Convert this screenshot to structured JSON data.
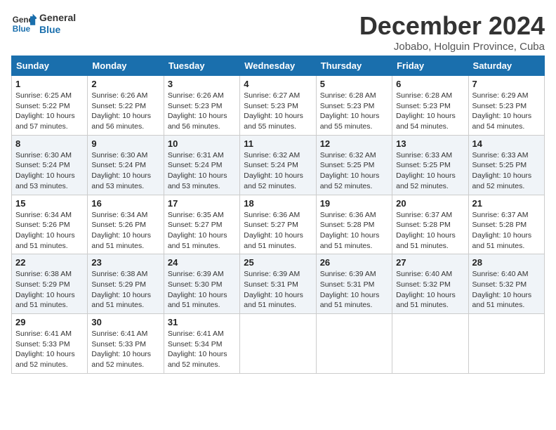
{
  "logo": {
    "line1": "General",
    "line2": "Blue"
  },
  "title": "December 2024",
  "location": "Jobabo, Holguin Province, Cuba",
  "headers": [
    "Sunday",
    "Monday",
    "Tuesday",
    "Wednesday",
    "Thursday",
    "Friday",
    "Saturday"
  ],
  "weeks": [
    [
      {
        "day": "1",
        "sunrise": "6:25 AM",
        "sunset": "5:22 PM",
        "daylight": "10 hours and 57 minutes."
      },
      {
        "day": "2",
        "sunrise": "6:26 AM",
        "sunset": "5:22 PM",
        "daylight": "10 hours and 56 minutes."
      },
      {
        "day": "3",
        "sunrise": "6:26 AM",
        "sunset": "5:23 PM",
        "daylight": "10 hours and 56 minutes."
      },
      {
        "day": "4",
        "sunrise": "6:27 AM",
        "sunset": "5:23 PM",
        "daylight": "10 hours and 55 minutes."
      },
      {
        "day": "5",
        "sunrise": "6:28 AM",
        "sunset": "5:23 PM",
        "daylight": "10 hours and 55 minutes."
      },
      {
        "day": "6",
        "sunrise": "6:28 AM",
        "sunset": "5:23 PM",
        "daylight": "10 hours and 54 minutes."
      },
      {
        "day": "7",
        "sunrise": "6:29 AM",
        "sunset": "5:23 PM",
        "daylight": "10 hours and 54 minutes."
      }
    ],
    [
      {
        "day": "8",
        "sunrise": "6:30 AM",
        "sunset": "5:24 PM",
        "daylight": "10 hours and 53 minutes."
      },
      {
        "day": "9",
        "sunrise": "6:30 AM",
        "sunset": "5:24 PM",
        "daylight": "10 hours and 53 minutes."
      },
      {
        "day": "10",
        "sunrise": "6:31 AM",
        "sunset": "5:24 PM",
        "daylight": "10 hours and 53 minutes."
      },
      {
        "day": "11",
        "sunrise": "6:32 AM",
        "sunset": "5:24 PM",
        "daylight": "10 hours and 52 minutes."
      },
      {
        "day": "12",
        "sunrise": "6:32 AM",
        "sunset": "5:25 PM",
        "daylight": "10 hours and 52 minutes."
      },
      {
        "day": "13",
        "sunrise": "6:33 AM",
        "sunset": "5:25 PM",
        "daylight": "10 hours and 52 minutes."
      },
      {
        "day": "14",
        "sunrise": "6:33 AM",
        "sunset": "5:25 PM",
        "daylight": "10 hours and 52 minutes."
      }
    ],
    [
      {
        "day": "15",
        "sunrise": "6:34 AM",
        "sunset": "5:26 PM",
        "daylight": "10 hours and 51 minutes."
      },
      {
        "day": "16",
        "sunrise": "6:34 AM",
        "sunset": "5:26 PM",
        "daylight": "10 hours and 51 minutes."
      },
      {
        "day": "17",
        "sunrise": "6:35 AM",
        "sunset": "5:27 PM",
        "daylight": "10 hours and 51 minutes."
      },
      {
        "day": "18",
        "sunrise": "6:36 AM",
        "sunset": "5:27 PM",
        "daylight": "10 hours and 51 minutes."
      },
      {
        "day": "19",
        "sunrise": "6:36 AM",
        "sunset": "5:28 PM",
        "daylight": "10 hours and 51 minutes."
      },
      {
        "day": "20",
        "sunrise": "6:37 AM",
        "sunset": "5:28 PM",
        "daylight": "10 hours and 51 minutes."
      },
      {
        "day": "21",
        "sunrise": "6:37 AM",
        "sunset": "5:28 PM",
        "daylight": "10 hours and 51 minutes."
      }
    ],
    [
      {
        "day": "22",
        "sunrise": "6:38 AM",
        "sunset": "5:29 PM",
        "daylight": "10 hours and 51 minutes."
      },
      {
        "day": "23",
        "sunrise": "6:38 AM",
        "sunset": "5:29 PM",
        "daylight": "10 hours and 51 minutes."
      },
      {
        "day": "24",
        "sunrise": "6:39 AM",
        "sunset": "5:30 PM",
        "daylight": "10 hours and 51 minutes."
      },
      {
        "day": "25",
        "sunrise": "6:39 AM",
        "sunset": "5:31 PM",
        "daylight": "10 hours and 51 minutes."
      },
      {
        "day": "26",
        "sunrise": "6:39 AM",
        "sunset": "5:31 PM",
        "daylight": "10 hours and 51 minutes."
      },
      {
        "day": "27",
        "sunrise": "6:40 AM",
        "sunset": "5:32 PM",
        "daylight": "10 hours and 51 minutes."
      },
      {
        "day": "28",
        "sunrise": "6:40 AM",
        "sunset": "5:32 PM",
        "daylight": "10 hours and 51 minutes."
      }
    ],
    [
      {
        "day": "29",
        "sunrise": "6:41 AM",
        "sunset": "5:33 PM",
        "daylight": "10 hours and 52 minutes."
      },
      {
        "day": "30",
        "sunrise": "6:41 AM",
        "sunset": "5:33 PM",
        "daylight": "10 hours and 52 minutes."
      },
      {
        "day": "31",
        "sunrise": "6:41 AM",
        "sunset": "5:34 PM",
        "daylight": "10 hours and 52 minutes."
      },
      null,
      null,
      null,
      null
    ]
  ]
}
